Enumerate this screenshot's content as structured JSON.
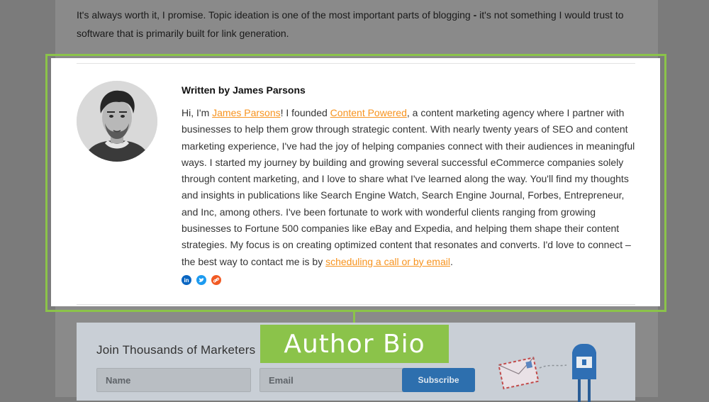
{
  "intro": {
    "line1_pre": "It's always worth it, I promise. Topic ideation is one of the most important parts of blogging ",
    "line1_dash": "-",
    "line1_post": " it's not something I would trust to software that is primarily built for link generation."
  },
  "author_bio": {
    "title": "Written by James Parsons",
    "bio": {
      "p1": "Hi, I'm ",
      "link_name": "James Parsons",
      "p2": "! I founded ",
      "link_company": "Content Powered",
      "p3": ", a content marketing agency where I partner with businesses to help them grow through strategic content. With nearly twenty years of SEO and content marketing experience, I've had the joy of helping companies connect with their audiences in meaningful ways. I started my journey by building and growing several successful eCommerce companies solely through content marketing, and I love to share what I've learned along the way. You'll find my thoughts and insights in publications like Search Engine Watch, Search Engine Journal, Forbes, Entrepreneur, and Inc, among others. I've been fortunate to work with wonderful clients ranging from growing businesses to Fortune 500 companies like eBay and Expedia, and helping them shape their content strategies. My focus is on creating optimized content that resonates and converts. I'd love to connect – the best way to contact me is by ",
      "link_contact": "scheduling a call or by email",
      "p4": "."
    },
    "socials": [
      {
        "icon": "linkedin-icon",
        "color": "#0a66c2",
        "glyph": "in"
      },
      {
        "icon": "twitter-icon",
        "color": "#1d9bf0",
        "glyph": "t"
      },
      {
        "icon": "website-link-icon",
        "color": "#f15a24",
        "glyph": "link"
      }
    ]
  },
  "newsletter": {
    "title": "Join Thousands of Marketers",
    "name_placeholder": "Name",
    "email_placeholder": "Email",
    "subscribe_label": "Subscribe"
  },
  "annotation": {
    "label": "Author Bio",
    "color": "#8bc34a"
  }
}
